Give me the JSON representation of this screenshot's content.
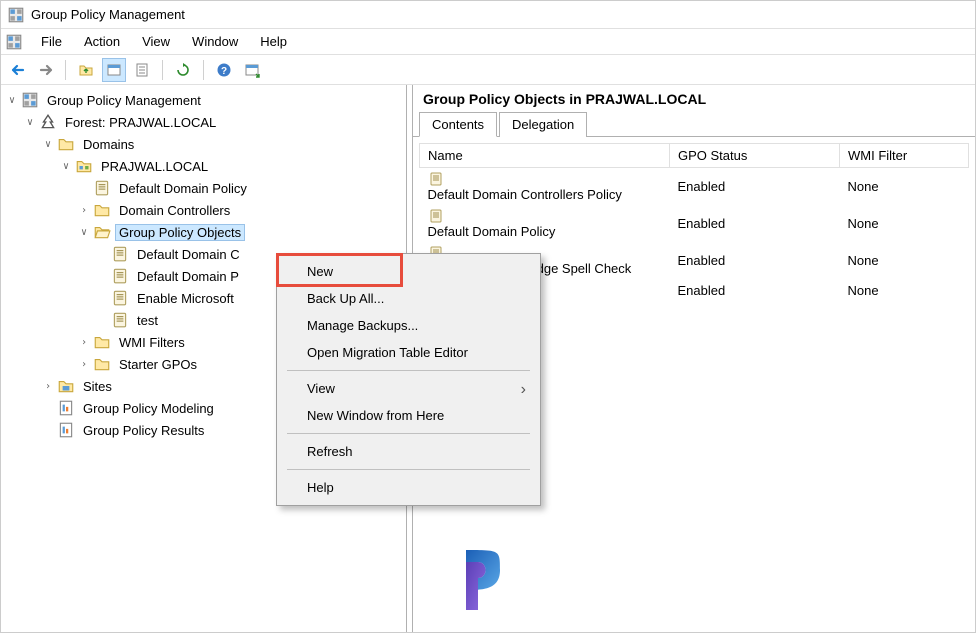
{
  "window_title": "Group Policy Management",
  "menubar": [
    "File",
    "Action",
    "View",
    "Window",
    "Help"
  ],
  "tree": {
    "root": "Group Policy Management",
    "forest": "Forest: PRAJWAL.LOCAL",
    "domains": "Domains",
    "domain": "PRAJWAL.LOCAL",
    "default_policy": "Default Domain Policy",
    "domain_controllers": "Domain Controllers",
    "gpo": "Group Policy Objects",
    "gpo_children": [
      "Default Domain C",
      "Default Domain P",
      "Enable Microsoft",
      "test"
    ],
    "wmi": "WMI Filters",
    "starter": "Starter GPOs",
    "sites": "Sites",
    "modeling": "Group Policy Modeling",
    "results": "Group Policy Results"
  },
  "right": {
    "title": "Group Policy Objects in PRAJWAL.LOCAL",
    "tabs": [
      "Contents",
      "Delegation"
    ],
    "columns": [
      "Name",
      "GPO Status",
      "WMI Filter"
    ],
    "rows": [
      {
        "name": "Default Domain Controllers Policy",
        "status": "Enabled",
        "wmi": "None"
      },
      {
        "name": "Default Domain Policy",
        "status": "Enabled",
        "wmi": "None"
      },
      {
        "name": "Enable Microsoft Edge Spell Check",
        "status": "Enabled",
        "wmi": "None"
      },
      {
        "name": "",
        "status": "Enabled",
        "wmi": "None"
      }
    ]
  },
  "context_menu": [
    {
      "label": "New",
      "type": "item"
    },
    {
      "label": "Back Up All...",
      "type": "item"
    },
    {
      "label": "Manage Backups...",
      "type": "item"
    },
    {
      "label": "Open Migration Table Editor",
      "type": "item"
    },
    {
      "type": "sep"
    },
    {
      "label": "View",
      "type": "sub"
    },
    {
      "label": "New Window from Here",
      "type": "item"
    },
    {
      "type": "sep"
    },
    {
      "label": "Refresh",
      "type": "item"
    },
    {
      "type": "sep"
    },
    {
      "label": "Help",
      "type": "item"
    }
  ]
}
